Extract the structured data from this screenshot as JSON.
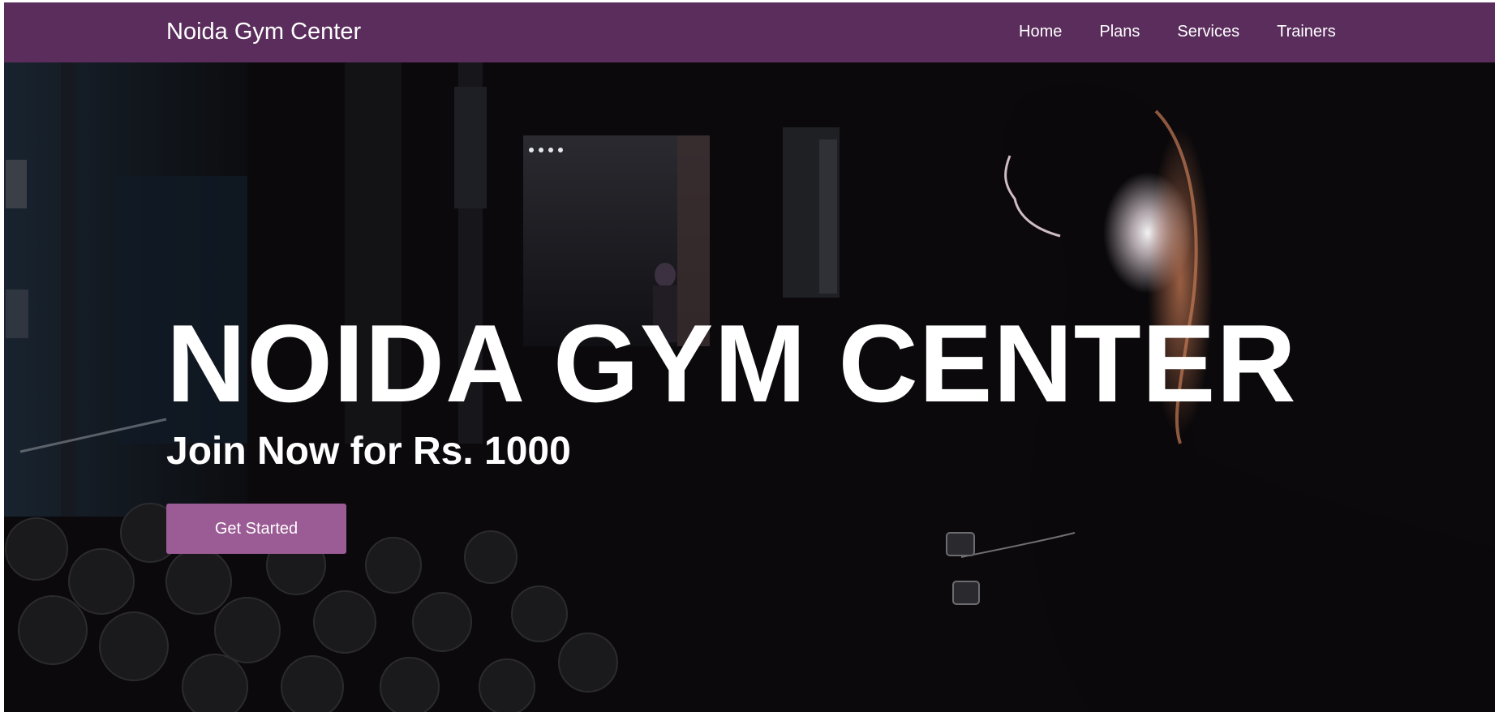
{
  "navbar": {
    "brand": "Noida Gym Center",
    "links": [
      "Home",
      "Plans",
      "Services",
      "Trainers"
    ],
    "background_color": "#5a2d5c"
  },
  "hero": {
    "title": "NOIDA GYM CENTER",
    "subtitle": "Join Now for Rs. 1000",
    "cta_label": "Get Started",
    "cta_color": "#9b5b95",
    "background_image": "dark gym photo with silhouette of woman and dumbbell rack"
  }
}
